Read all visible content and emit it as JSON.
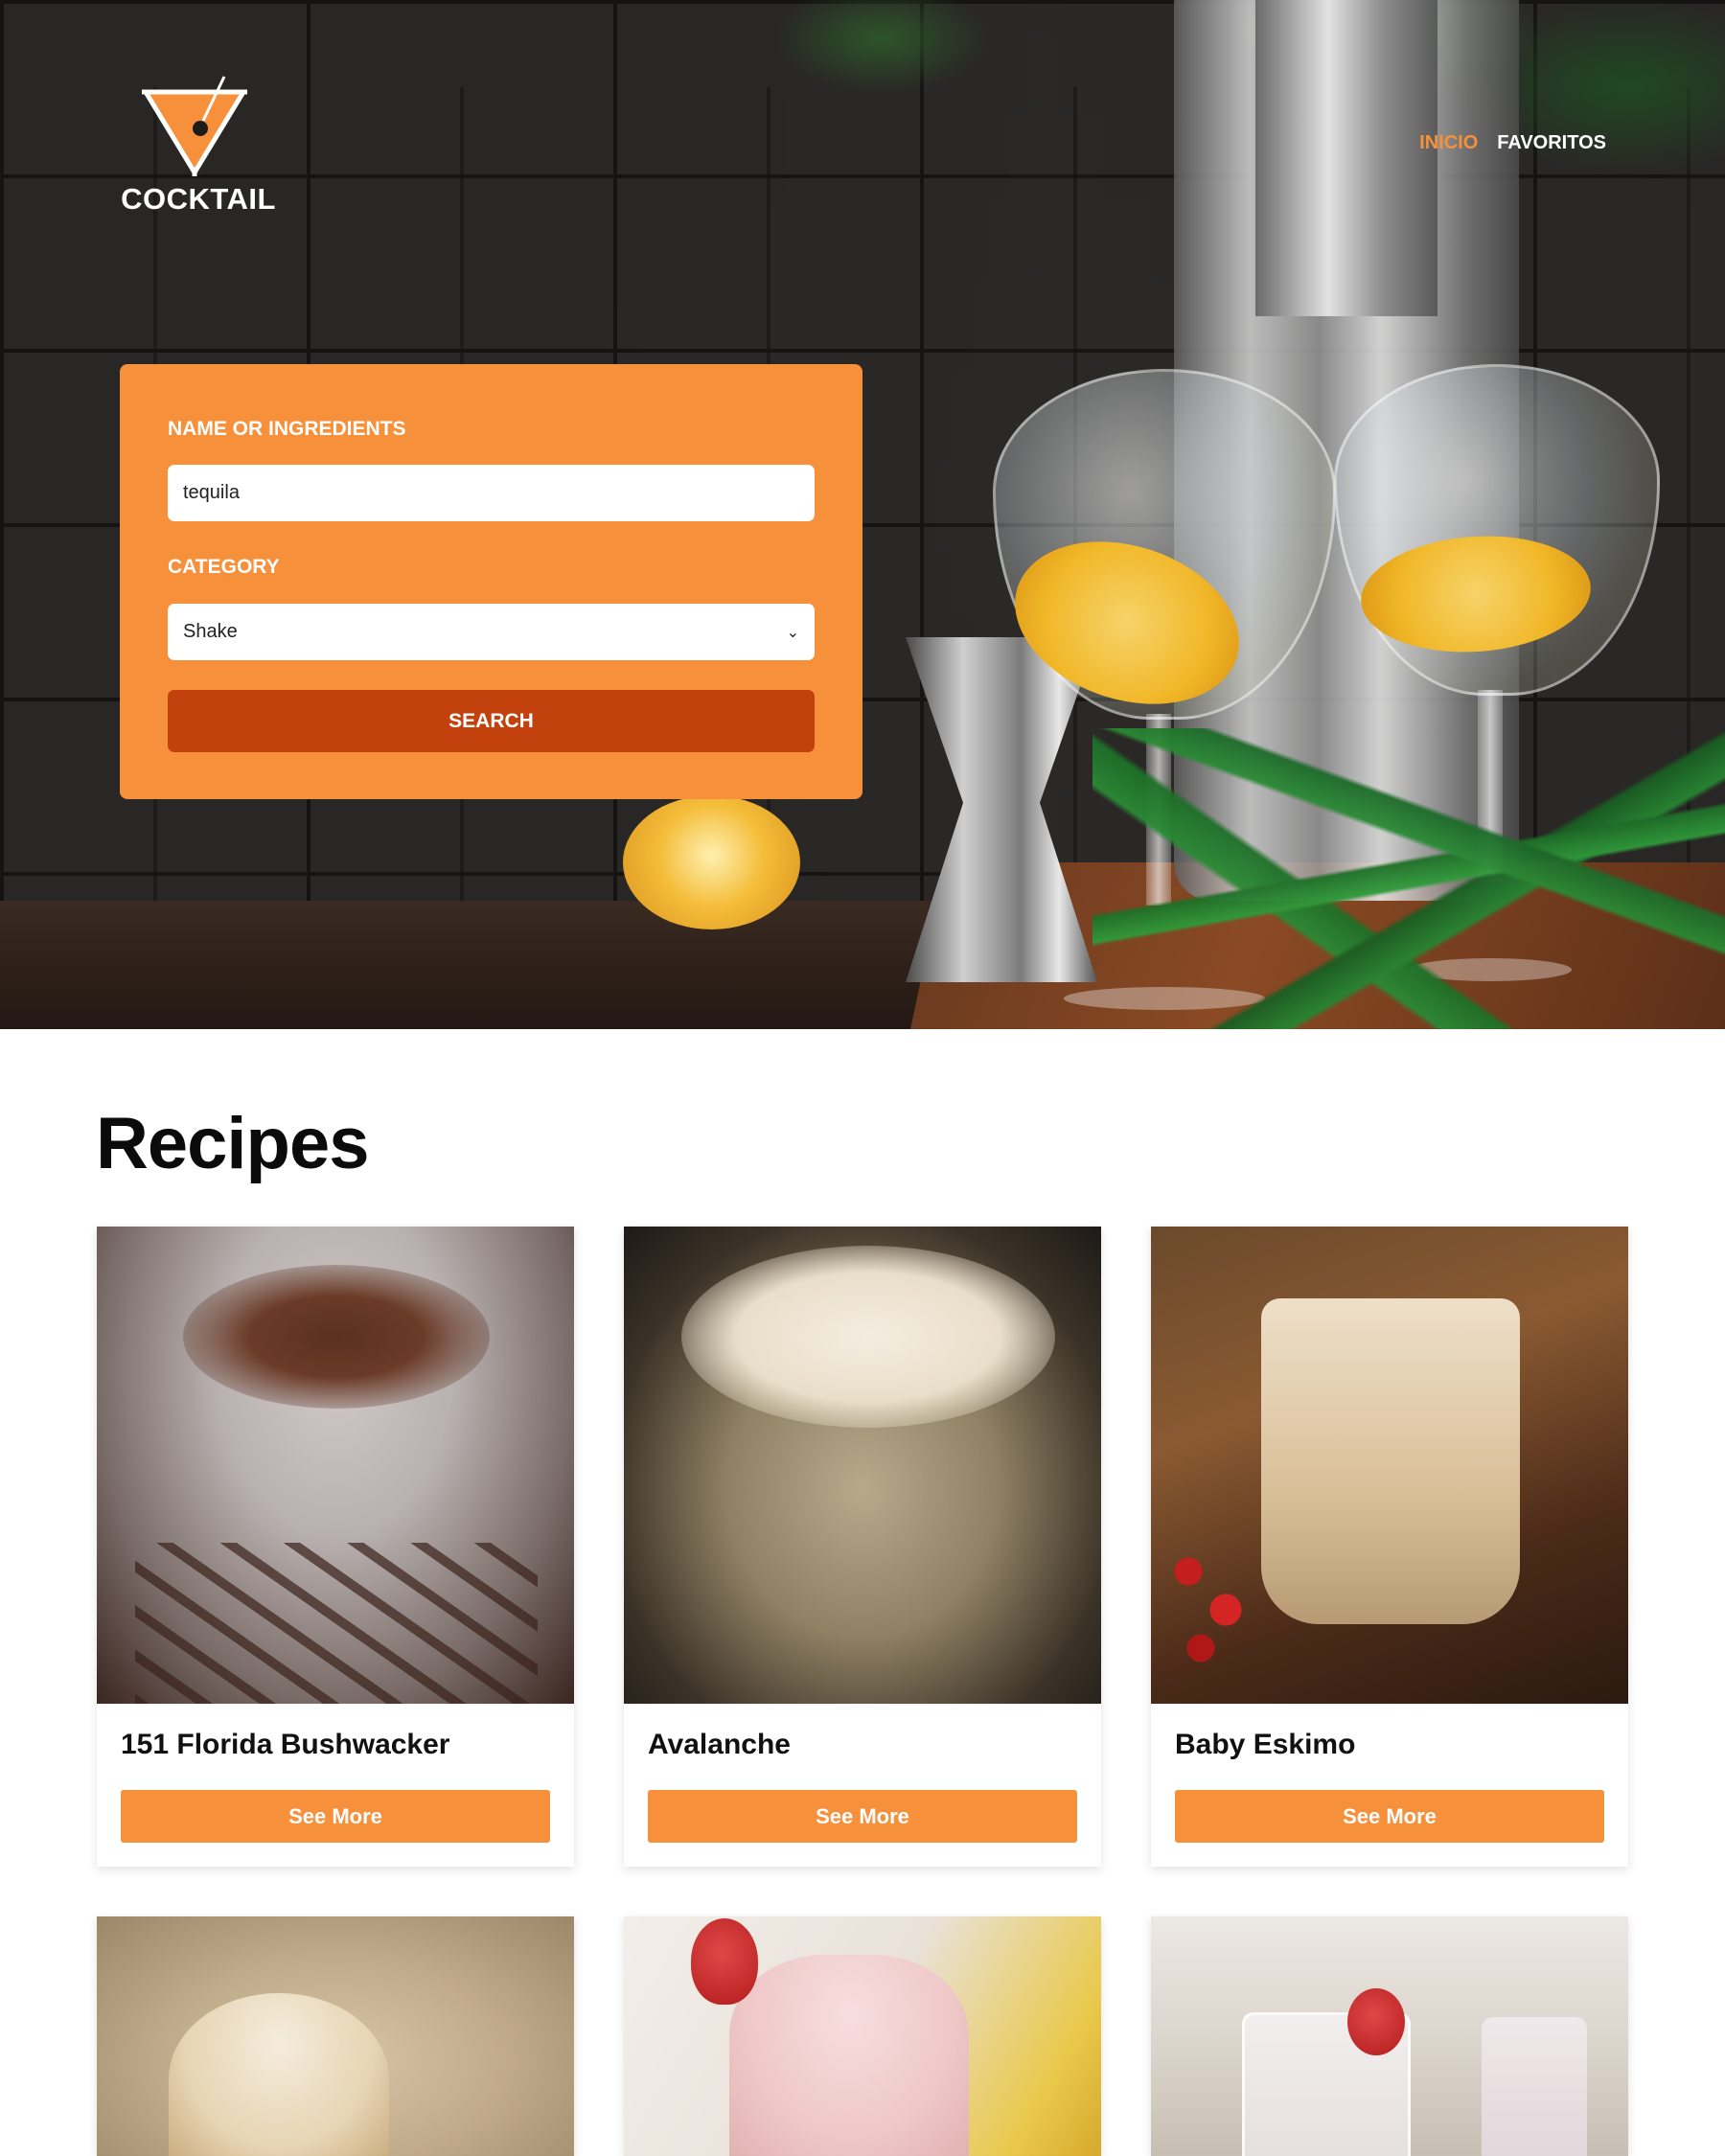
{
  "brand": {
    "name": "COCKTAIL",
    "logo_icon": "martini-glass-icon",
    "accent": "#f7903b"
  },
  "nav": {
    "items": [
      {
        "label": "INICIO",
        "active": true
      },
      {
        "label": "FAVORITOS",
        "active": false
      }
    ]
  },
  "search": {
    "name_label": "NAME OR INGREDIENTS",
    "name_value": "tequila",
    "category_label": "CATEGORY",
    "category_value": "Shake",
    "button_label": "SEARCH"
  },
  "recipes": {
    "title": "Recipes",
    "button_label": "See More",
    "items": [
      {
        "name": "151 Florida Bushwacker"
      },
      {
        "name": "Avalanche"
      },
      {
        "name": "Baby Eskimo"
      },
      {
        "name": ""
      },
      {
        "name": ""
      },
      {
        "name": ""
      }
    ]
  },
  "colors": {
    "card_orange": "#f7903b",
    "search_button": "#c2410c",
    "text_dark": "#0b0b0b"
  }
}
